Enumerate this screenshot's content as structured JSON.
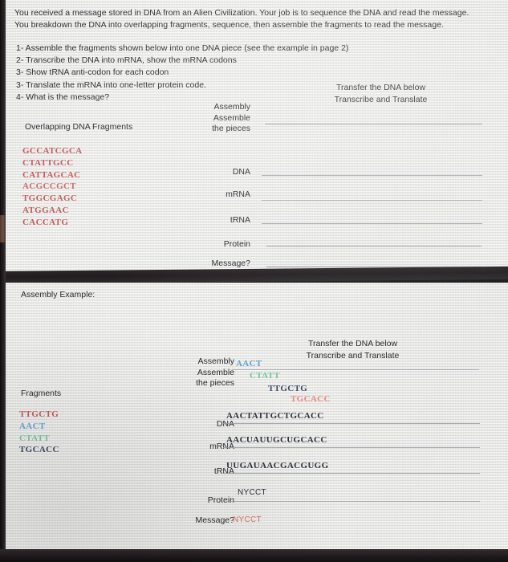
{
  "document": {
    "intro_line_1": "You received a message stored in DNA from an Alien Civilization. Your job is to sequence the DNA and read the message.",
    "intro_line_2": "You breakdown the DNA into overlapping fragments, sequence, then assemble the fragments to read the message.",
    "tasks": [
      "1- Assemble the fragments shown below into one DNA piece (see the example in page 2)",
      "2- Transcribe the DNA into mRNA, show the mRNA codons",
      "3- Show tRNA anti-codon for each codon",
      "3- Translate the mRNA into one-letter protein code.",
      "4- What is the message?"
    ]
  },
  "transfer_note": {
    "line_1": "Transfer the DNA below",
    "line_2": "Transcribe and Translate"
  },
  "labels": {
    "assembly_l1": "Assembly",
    "assembly_l2": "Assemble",
    "assembly_l3": "the pieces",
    "dna": "DNA",
    "mrna": "mRNA",
    "trna": "tRNA",
    "protein": "Protein",
    "message": "Message?"
  },
  "problem": {
    "fragments_heading": "Overlapping DNA Fragments",
    "fragments": [
      {
        "seq": "GCCATCGCA",
        "color": "#c25a5c"
      },
      {
        "seq": "CTATTGCC",
        "color": "#c25a5c"
      },
      {
        "seq": "CATTAGCAC",
        "color": "#c25a5c"
      },
      {
        "seq": "ACGCCGCT",
        "color": "#c96a6c"
      },
      {
        "seq": "TGGCGAGC",
        "color": "#c25a5c"
      },
      {
        "seq": "ATGGAAC",
        "color": "#c25a5c"
      },
      {
        "seq": "CACCATG",
        "color": "#c25a5c"
      }
    ],
    "answers": {
      "assembly": "",
      "dna": "",
      "mrna": "",
      "trna": "",
      "protein": "",
      "message": ""
    }
  },
  "example": {
    "heading": "Assembly Example:",
    "fragments_heading": "Fragments",
    "fragments": [
      {
        "seq": "TTGCTG",
        "color": "#c25a5c"
      },
      {
        "seq": "AACT",
        "color": "#6aa7d4"
      },
      {
        "seq": "CTATT",
        "color": "#7fc3a3"
      },
      {
        "seq": "TGCACC",
        "color": "#3f4a63"
      }
    ],
    "assembly_stack": [
      {
        "seq": "AACT",
        "color": "#5fa3d6",
        "indent": 0
      },
      {
        "seq": "CTATT",
        "color": "#79c09d",
        "indent": 17
      },
      {
        "seq": "TTGCTG",
        "color": "#3f4a63",
        "indent": 40
      },
      {
        "seq": "TGCACC",
        "color": "#e88a7d",
        "indent": 68
      }
    ],
    "answers": {
      "dna": "AACTATTGCTGCACC",
      "mrna": "AACUAUUGCUGCACC",
      "trna": "UUGAUAACGACGUGG",
      "protein": "NYCCT",
      "message": "NYCCT",
      "message_color": "#d9736f"
    }
  }
}
